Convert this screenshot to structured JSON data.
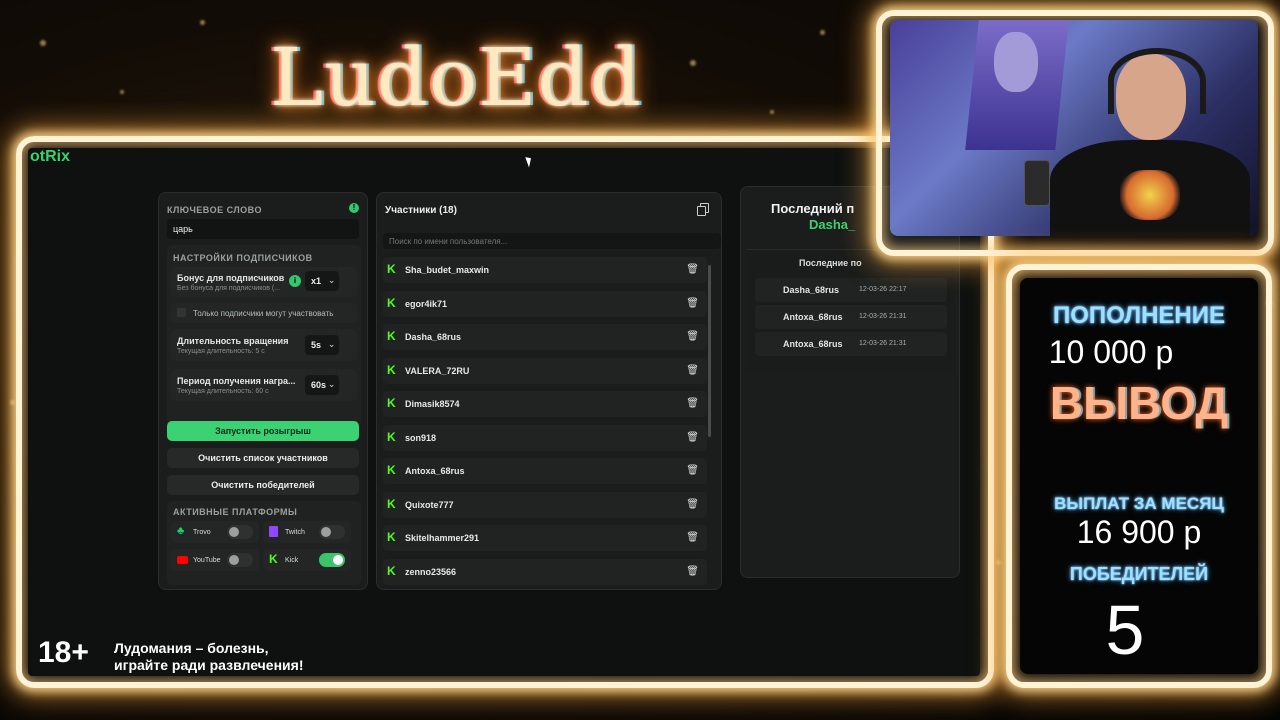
{
  "logo_text": "LudoEdd",
  "app": {
    "brand": "otRix",
    "keyword": {
      "label": "КЛЮЧЕВОЕ СЛОВО",
      "value": "царь"
    },
    "subscriber_settings": {
      "label": "НАСТРОЙКИ ПОДПИСЧИКОВ",
      "bonus_title": "Бонус для подписчиков",
      "bonus_sub": "Без бонуса для подписчиков (...",
      "bonus_value": "x1",
      "only_subs": "Только подписчики могут участвовать",
      "spin_title": "Длительность вращения",
      "spin_sub": "Текущая длительность: 5 с",
      "spin_value": "5s",
      "period_title": "Период получения награ...",
      "period_sub": "Текущая длительность: 60 с",
      "period_value": "60s"
    },
    "buttons": {
      "start": "Запустить розыгрыш",
      "clear_participants": "Очистить список участников",
      "clear_winners": "Очистить победителей"
    },
    "platforms": {
      "label": "АКТИВНЫЕ ПЛАТФОРМЫ",
      "items": [
        {
          "name": "Trovo",
          "on": false
        },
        {
          "name": "Twitch",
          "on": false
        },
        {
          "name": "YouTube",
          "on": false
        },
        {
          "name": "Kick",
          "on": true
        }
      ]
    },
    "participants": {
      "title": "Участники (18)",
      "search_placeholder": "Поиск по имени пользователя...",
      "list": [
        "Sha_budet_maxwin",
        "egor4ik71",
        "Dasha_68rus",
        "VALERA_72RU",
        "Dimasik8574",
        "son918",
        "Antoxa_68rus",
        "Quixote777",
        "Skitelhammer291",
        "zenno23566"
      ]
    },
    "winners": {
      "title": "Последний п",
      "winner_name": "Dasha_",
      "recent_label": "Последние по",
      "list": [
        {
          "name": "Dasha_68rus",
          "date": "12-03-26 22:17"
        },
        {
          "name": "Antoxa_68rus",
          "date": "12-03-26 21:31"
        },
        {
          "name": "Antoxa_68rus",
          "date": "12-03-26 21:31"
        }
      ]
    }
  },
  "stats": {
    "deposit_label": "ПОПОЛНЕНИЕ",
    "deposit_value": "10 000 р",
    "withdraw_label": "ВЫВОД",
    "monthly_label": "ВЫПЛАТ ЗА МЕСЯЦ",
    "monthly_value": "16 900 р",
    "winners_label": "ПОБЕДИТЕЛЕЙ",
    "winners_value": "5"
  },
  "disclaimer": {
    "age": "18+",
    "line1": "Лудомания – болезнь,",
    "line2": "играйте ради развлечения!"
  }
}
